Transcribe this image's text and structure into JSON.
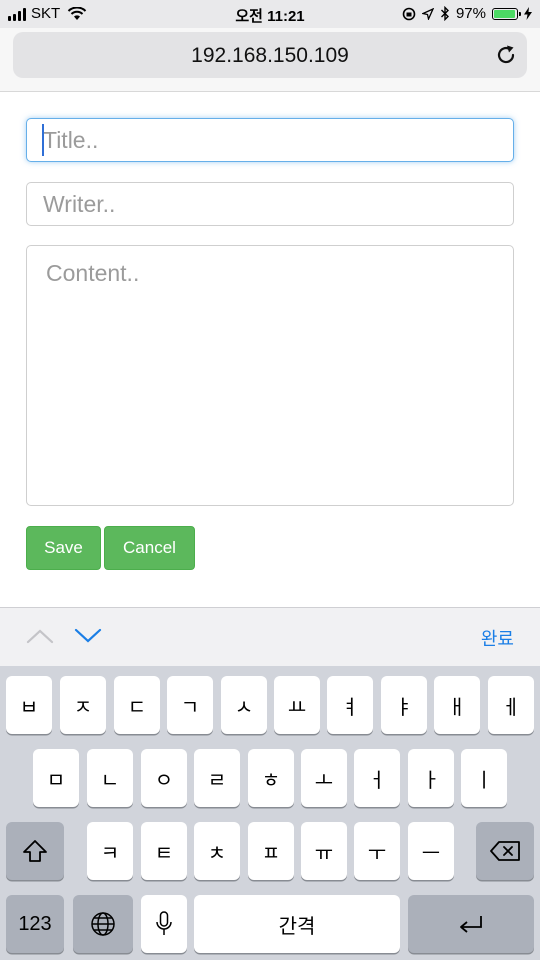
{
  "status_bar": {
    "carrier": "SKT",
    "time": "오전 11:21",
    "battery_percent_label": "97%",
    "battery_level": 0.97,
    "battery_color": "#4cd964"
  },
  "browser": {
    "url": "192.168.150.109",
    "reload_icon": "reload-icon"
  },
  "form": {
    "title_placeholder": "Title..",
    "writer_placeholder": "Writer..",
    "content_placeholder": "Content..",
    "save_label": "Save",
    "cancel_label": "Cancel",
    "button_color": "#5cb85c",
    "focus_color": "#66afe9"
  },
  "keyboard_accessory": {
    "done_label": "완료",
    "accent": "#1a7ee6"
  },
  "keyboard": {
    "row1": [
      "ㅂ",
      "ㅈ",
      "ㄷ",
      "ㄱ",
      "ㅅ",
      "ㅛ",
      "ㅕ",
      "ㅑ",
      "ㅐ",
      "ㅔ"
    ],
    "row2": [
      "ㅁ",
      "ㄴ",
      "ㅇ",
      "ㄹ",
      "ㅎ",
      "ㅗ",
      "ㅓ",
      "ㅏ",
      "ㅣ"
    ],
    "row3": [
      "ㅋ",
      "ㅌ",
      "ㅊ",
      "ㅍ",
      "ㅠ",
      "ㅜ",
      "ㅡ"
    ],
    "numbers_label": "123",
    "space_label": "간격"
  }
}
